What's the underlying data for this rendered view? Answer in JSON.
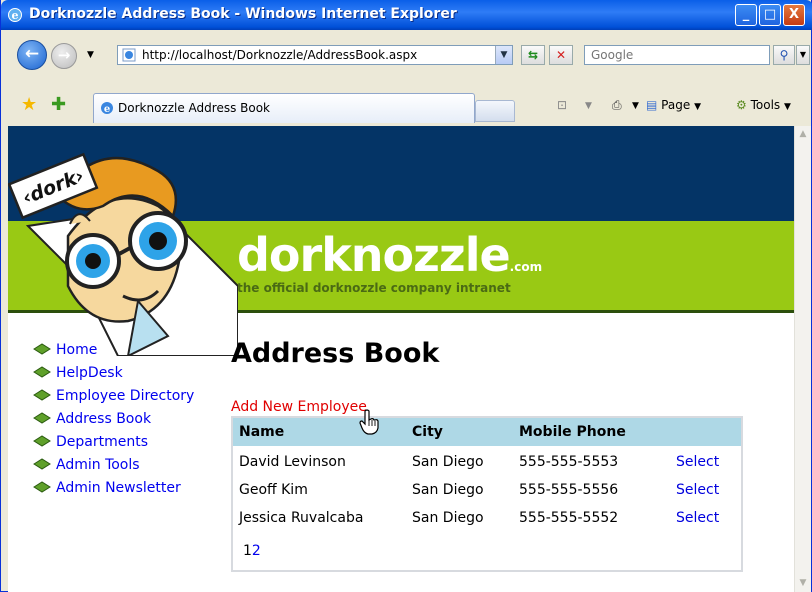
{
  "window": {
    "title": "Dorknozzle Address Book - Windows Internet Explorer",
    "buttons": {
      "minimize": "_",
      "maximize": "□",
      "close": "X"
    }
  },
  "address_bar": {
    "url": "http://localhost/Dorknozzle/AddressBook.aspx",
    "search_placeholder": "Google"
  },
  "command_bar": {
    "tab_title": "Dorknozzle Address Book",
    "page_label": "Page",
    "tools_label": "Tools"
  },
  "site": {
    "logo_badge": "‹dork›",
    "brand_name": "dorknozzle",
    "brand_suffix": ".com",
    "tagline": "the official dorknozzle company intranet"
  },
  "nav": {
    "items": [
      {
        "label": "Home"
      },
      {
        "label": "HelpDesk"
      },
      {
        "label": "Employee Directory"
      },
      {
        "label": "Address Book"
      },
      {
        "label": "Departments"
      },
      {
        "label": "Admin Tools"
      },
      {
        "label": "Admin Newsletter"
      }
    ]
  },
  "main": {
    "title": "Address Book",
    "add_link": "Add New Employee",
    "columns": [
      "Name",
      "City",
      "Mobile Phone"
    ],
    "rows": [
      {
        "name": "David Levinson",
        "city": "San Diego",
        "phone": "555-555-5553",
        "action": "Select"
      },
      {
        "name": "Geoff Kim",
        "city": "San Diego",
        "phone": "555-555-5556",
        "action": "Select"
      },
      {
        "name": "Jessica Ruvalcaba",
        "city": "San Diego",
        "phone": "555-555-5552",
        "action": "Select"
      }
    ],
    "pager": {
      "current": "1",
      "next": "2"
    }
  },
  "colors": {
    "header_dark": "#043466",
    "header_green": "#99C914",
    "grid_header": "#AED8E6",
    "link": "#0000EE",
    "add_link": "#E00000"
  }
}
